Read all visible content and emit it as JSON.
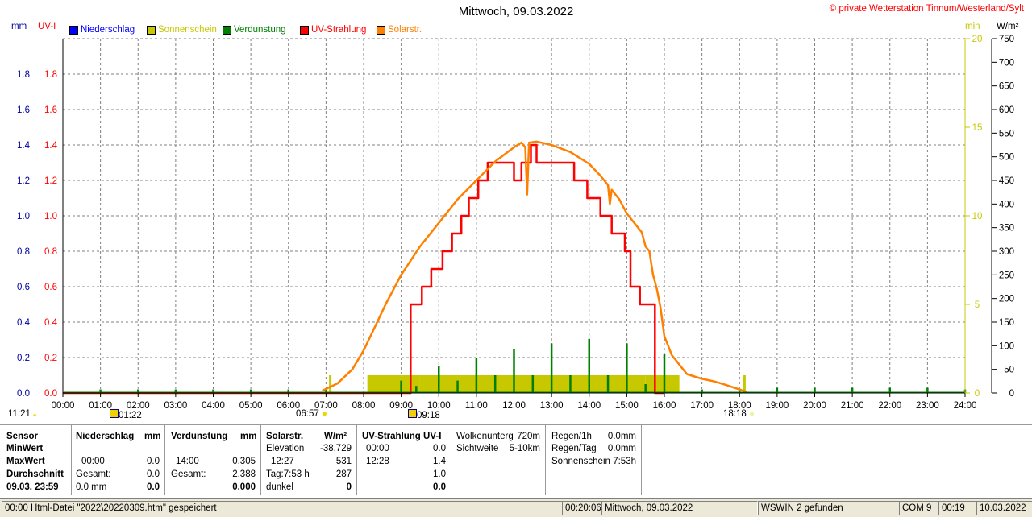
{
  "header": {
    "title": "Mittwoch, 09.03.2022",
    "copyright": "© private Wetterstation Tinnum/Westerland/Sylt"
  },
  "axes": {
    "left_unit_mm": "mm",
    "left_unit_uvi": "UV-I",
    "right_unit_min": "min",
    "right_unit_wm2": "W/m²"
  },
  "legend": [
    {
      "label": "Niederschlag",
      "color": "#0000ff"
    },
    {
      "label": "Sonnenschein",
      "color": "#c8c800"
    },
    {
      "label": "Verdunstung",
      "color": "#008000"
    },
    {
      "label": "UV-Strahlung",
      "color": "#ff0000"
    },
    {
      "label": "Solarstr.",
      "color": "#ff8000"
    }
  ],
  "markers": {
    "moon_set": "11:21",
    "moon_rise": "01:22",
    "sunrise": "06:57",
    "uv_start": "09:18",
    "sunset": "18:18"
  },
  "chart_data": {
    "type": "line",
    "title": "Mittwoch, 09.03.2022",
    "x_ticks": [
      "00:00",
      "01:00",
      "02:00",
      "03:00",
      "04:00",
      "05:00",
      "06:00",
      "07:00",
      "08:00",
      "09:00",
      "10:00",
      "11:00",
      "12:00",
      "13:00",
      "14:00",
      "15:00",
      "16:00",
      "17:00",
      "18:00",
      "19:00",
      "20:00",
      "21:00",
      "22:00",
      "23:00",
      "24:00"
    ],
    "xlim": [
      0,
      24
    ],
    "y_mm_ticks": [
      "0.0",
      "0.2",
      "0.4",
      "0.6",
      "0.8",
      "1.0",
      "1.2",
      "1.4",
      "1.6",
      "1.8"
    ],
    "y_uvi_ticks": [
      "0.0",
      "0.2",
      "0.4",
      "0.6",
      "0.8",
      "1.0",
      "1.2",
      "1.4",
      "1.6",
      "1.8"
    ],
    "y_left_lim": [
      0,
      2.0
    ],
    "y_min_ticks": [
      "0",
      "5",
      "10",
      "15",
      "20"
    ],
    "y_min_lim": [
      0,
      20
    ],
    "y_wm2_ticks": [
      "0",
      "50",
      "100",
      "150",
      "200",
      "250",
      "300",
      "350",
      "400",
      "450",
      "500",
      "550",
      "600",
      "650",
      "700",
      "750"
    ],
    "y_wm2_lim": [
      0,
      750
    ],
    "grid": true,
    "series": [
      {
        "name": "UV-Strahlung",
        "axis": "uvi",
        "color": "#ff0000",
        "kind": "step",
        "x": [
          0,
          9.25,
          9.25,
          9.55,
          9.55,
          9.8,
          9.8,
          10.1,
          10.1,
          10.35,
          10.35,
          10.6,
          10.6,
          10.8,
          10.8,
          11.05,
          11.05,
          11.3,
          11.3,
          11.55,
          11.55,
          12.0,
          12.0,
          12.2,
          12.2,
          12.45,
          12.45,
          12.6,
          12.6,
          12.8,
          12.8,
          13.6,
          13.6,
          13.95,
          13.95,
          14.3,
          14.3,
          14.6,
          14.6,
          14.95,
          14.95,
          15.1,
          15.1,
          15.35,
          15.35,
          15.75,
          15.75,
          16.0
        ],
        "y": [
          0,
          0,
          0.5,
          0.5,
          0.6,
          0.6,
          0.7,
          0.7,
          0.8,
          0.8,
          0.9,
          0.9,
          1.0,
          1.0,
          1.1,
          1.1,
          1.2,
          1.2,
          1.3,
          1.3,
          1.3,
          1.3,
          1.2,
          1.2,
          1.3,
          1.3,
          1.4,
          1.4,
          1.3,
          1.3,
          1.3,
          1.3,
          1.2,
          1.2,
          1.1,
          1.1,
          1.0,
          1.0,
          0.9,
          0.9,
          0.8,
          0.8,
          0.6,
          0.6,
          0.5,
          0.5,
          0,
          0
        ]
      },
      {
        "name": "Solarstr.",
        "axis": "wm2",
        "color": "#ff8000",
        "kind": "line",
        "x": [
          6.9,
          7.3,
          7.7,
          8.0,
          8.3,
          8.6,
          9.0,
          9.5,
          10.0,
          10.5,
          11.0,
          11.5,
          12.0,
          12.2,
          12.3,
          12.35,
          12.4,
          12.6,
          13.0,
          13.5,
          14.0,
          14.3,
          14.5,
          14.55,
          14.6,
          14.8,
          15.0,
          15.2,
          15.4,
          15.5,
          15.6,
          15.7,
          15.8,
          15.9,
          16.0,
          16.1,
          16.2,
          16.3,
          16.4,
          16.5,
          16.6,
          16.8,
          17.0,
          17.3,
          17.6,
          17.9,
          18.2
        ],
        "y": [
          5,
          20,
          50,
          90,
          140,
          190,
          250,
          310,
          360,
          410,
          450,
          490,
          520,
          530,
          520,
          420,
          530,
          532,
          525,
          510,
          485,
          460,
          440,
          400,
          430,
          410,
          380,
          360,
          340,
          310,
          300,
          250,
          220,
          180,
          120,
          100,
          80,
          70,
          60,
          50,
          40,
          35,
          30,
          25,
          18,
          10,
          2
        ]
      },
      {
        "name": "Sonnenschein",
        "axis": "min",
        "color": "#c8c800",
        "kind": "bars",
        "x": [
          7.08,
          8.1,
          8.5,
          9.0,
          9.5,
          10.0,
          10.5,
          11.0,
          11.5,
          12.0,
          12.5,
          13.0,
          13.5,
          14.0,
          14.5,
          15.0,
          15.5,
          15.9,
          18.1
        ],
        "y": [
          1,
          1,
          1,
          1,
          1,
          1,
          1,
          1,
          1,
          1,
          1,
          1,
          1,
          1,
          1,
          1,
          1,
          1,
          1
        ]
      },
      {
        "name": "Verdunstung",
        "axis": "mm",
        "color": "#008000",
        "kind": "spikes",
        "x": [
          1.0,
          2.0,
          3.0,
          4.0,
          5.0,
          6.0,
          7.0,
          9.0,
          9.4,
          10.0,
          10.5,
          11.0,
          11.5,
          12.0,
          12.5,
          13.0,
          13.5,
          14.0,
          14.5,
          15.0,
          15.5,
          16.0,
          17.0,
          18.0,
          19.0,
          20.0,
          21.0,
          22.0,
          23.0,
          24.0
        ],
        "y": [
          0.02,
          0.02,
          0.02,
          0.02,
          0.02,
          0.02,
          0.02,
          0.07,
          0.04,
          0.15,
          0.07,
          0.2,
          0.1,
          0.25,
          0.1,
          0.28,
          0.1,
          0.305,
          0.1,
          0.28,
          0.05,
          0.22,
          0.02,
          0.02,
          0.03,
          0.03,
          0.03,
          0.03,
          0.03,
          0.02
        ]
      }
    ]
  },
  "panels": {
    "sensor": {
      "head": "Sensor",
      "min": "MinWert",
      "max": "MaxWert",
      "avg": "Durchschnitt",
      "date": "09.03. 23:59"
    },
    "niederschlag": {
      "head": "Niederschlag",
      "unit": "mm",
      "max_time": "00:00",
      "max_val": "0.0",
      "total_label": "Gesamt:",
      "total_val": "0.0",
      "avg_val": "0.0 mm",
      "last_val": "0.0"
    },
    "verdunstung": {
      "head": "Verdunstung",
      "unit": "mm",
      "max_time": "14:00",
      "max_val": "0.305",
      "total_label": "Gesamt:",
      "total_val": "2.388",
      "last_val": "0.000"
    },
    "solar": {
      "head": "Solarstr.",
      "unit": "W/m²",
      "elev_label": "Elevation",
      "elev_val": "-38.729",
      "max_time": "12:27",
      "max_val": "531",
      "day_label": "Tag:7:53 h",
      "day_val": "287",
      "dark_label": "dunkel",
      "dark_val": "0"
    },
    "uv": {
      "head": "UV-Strahlung UV-I",
      "min_time": "00:00",
      "min_val": "0.0",
      "max_time": "12:28",
      "max_val": "1.4",
      "avg_val": "1.0",
      "last_val": "0.0"
    },
    "wolken": {
      "cloud_label": "Wolkenunterg",
      "cloud_val": "720m",
      "vis_label": "Sichtweite",
      "vis_val": "5-10km"
    },
    "regen": {
      "r1_label": "Regen/1h",
      "r1_val": "0.0mm",
      "rd_label": "Regen/Tag",
      "rd_val": "0.0mm",
      "sun_label": "Sonnenschein",
      "sun_val": "7:53h"
    }
  },
  "status": {
    "left": "00:00  Html-Datei  \"2022\\20220309.htm\"  gespeichert",
    "time": "00:20:06",
    "day": "Mittwoch, 09.03.2022",
    "wswin": "WSWIN 2 gefunden",
    "com": "COM 9",
    "clock": "00:19",
    "date": "10.03.2022"
  }
}
